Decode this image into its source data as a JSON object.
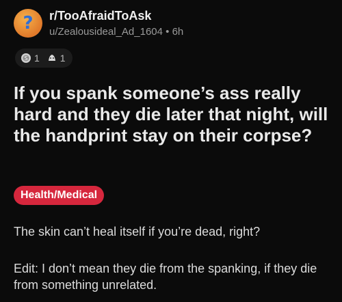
{
  "post": {
    "subreddit": "r/TooAfraidToAsk",
    "username": "u/Zealousideal_Ad_1604",
    "age": "6h",
    "awards": [
      {
        "icon": "silver-award-icon",
        "count": "1"
      },
      {
        "icon": "wholesome-award-icon",
        "count": "1"
      }
    ],
    "title": "If you spank someone’s ass really hard and they die later that night, will the handprint stay on their corpse?",
    "flair": "Health/Medical",
    "flair_color": "#d6273d",
    "body": [
      "The skin can’t heal itself if you’re dead, right?",
      "Edit: I don’t mean they die from the spanking, if they die from something unrelated."
    ]
  }
}
